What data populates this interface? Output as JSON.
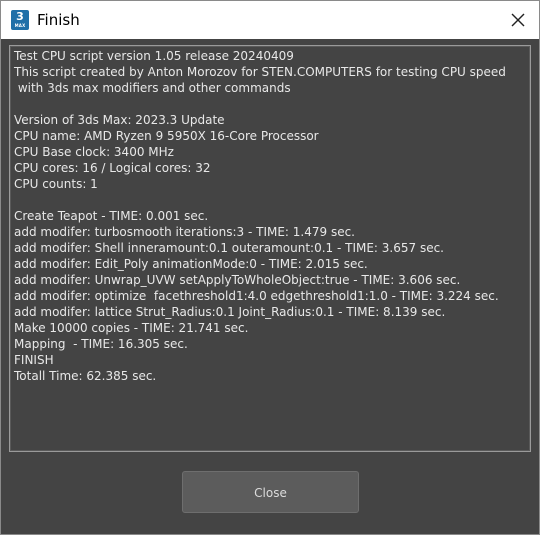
{
  "window": {
    "title": "Finish",
    "app_icon": {
      "name": "3ds-max-icon",
      "number": "3",
      "sub": "MAX",
      "color": "#1f6fa8"
    },
    "close_icon": "close-icon"
  },
  "log": {
    "lines": [
      "Test CPU script version 1.05 release 20240409",
      "This script created by Anton Morozov for STEN.COMPUTERS for testing CPU speed",
      " with 3ds max modifiers and other commands",
      "",
      "Version of 3ds Max: 2023.3 Update",
      "CPU name: AMD Ryzen 9 5950X 16-Core Processor",
      "CPU Base clock: 3400 MHz",
      "CPU cores: 16 / Logical cores: 32",
      "CPU counts: 1",
      "",
      "Create Teapot - TIME: 0.001 sec.",
      "add modifer: turbosmooth iterations:3 - TIME: 1.479 sec.",
      "add modifer: Shell inneramount:0.1 outeramount:0.1 - TIME: 3.657 sec.",
      "add modifer: Edit_Poly animationMode:0 - TIME: 2.015 sec.",
      "add modifer: Unwrap_UVW setApplyToWholeObject:true - TIME: 3.606 sec.",
      "add modifer: optimize  facethreshold1:4.0 edgethreshold1:1.0 - TIME: 3.224 sec.",
      "add modifer: lattice Strut_Radius:0.1 Joint_Radius:0.1 - TIME: 8.139 sec.",
      "Make 10000 copies - TIME: 21.741 sec.",
      "Mapping  - TIME: 16.305 sec.",
      "FINISH",
      "Totall Time: 62.385 sec."
    ]
  },
  "footer": {
    "close_label": "Close"
  },
  "colors": {
    "background": "#444444",
    "text": "#e8e8e8",
    "button": "#5c5c5c",
    "titlebar": "#ffffff"
  }
}
